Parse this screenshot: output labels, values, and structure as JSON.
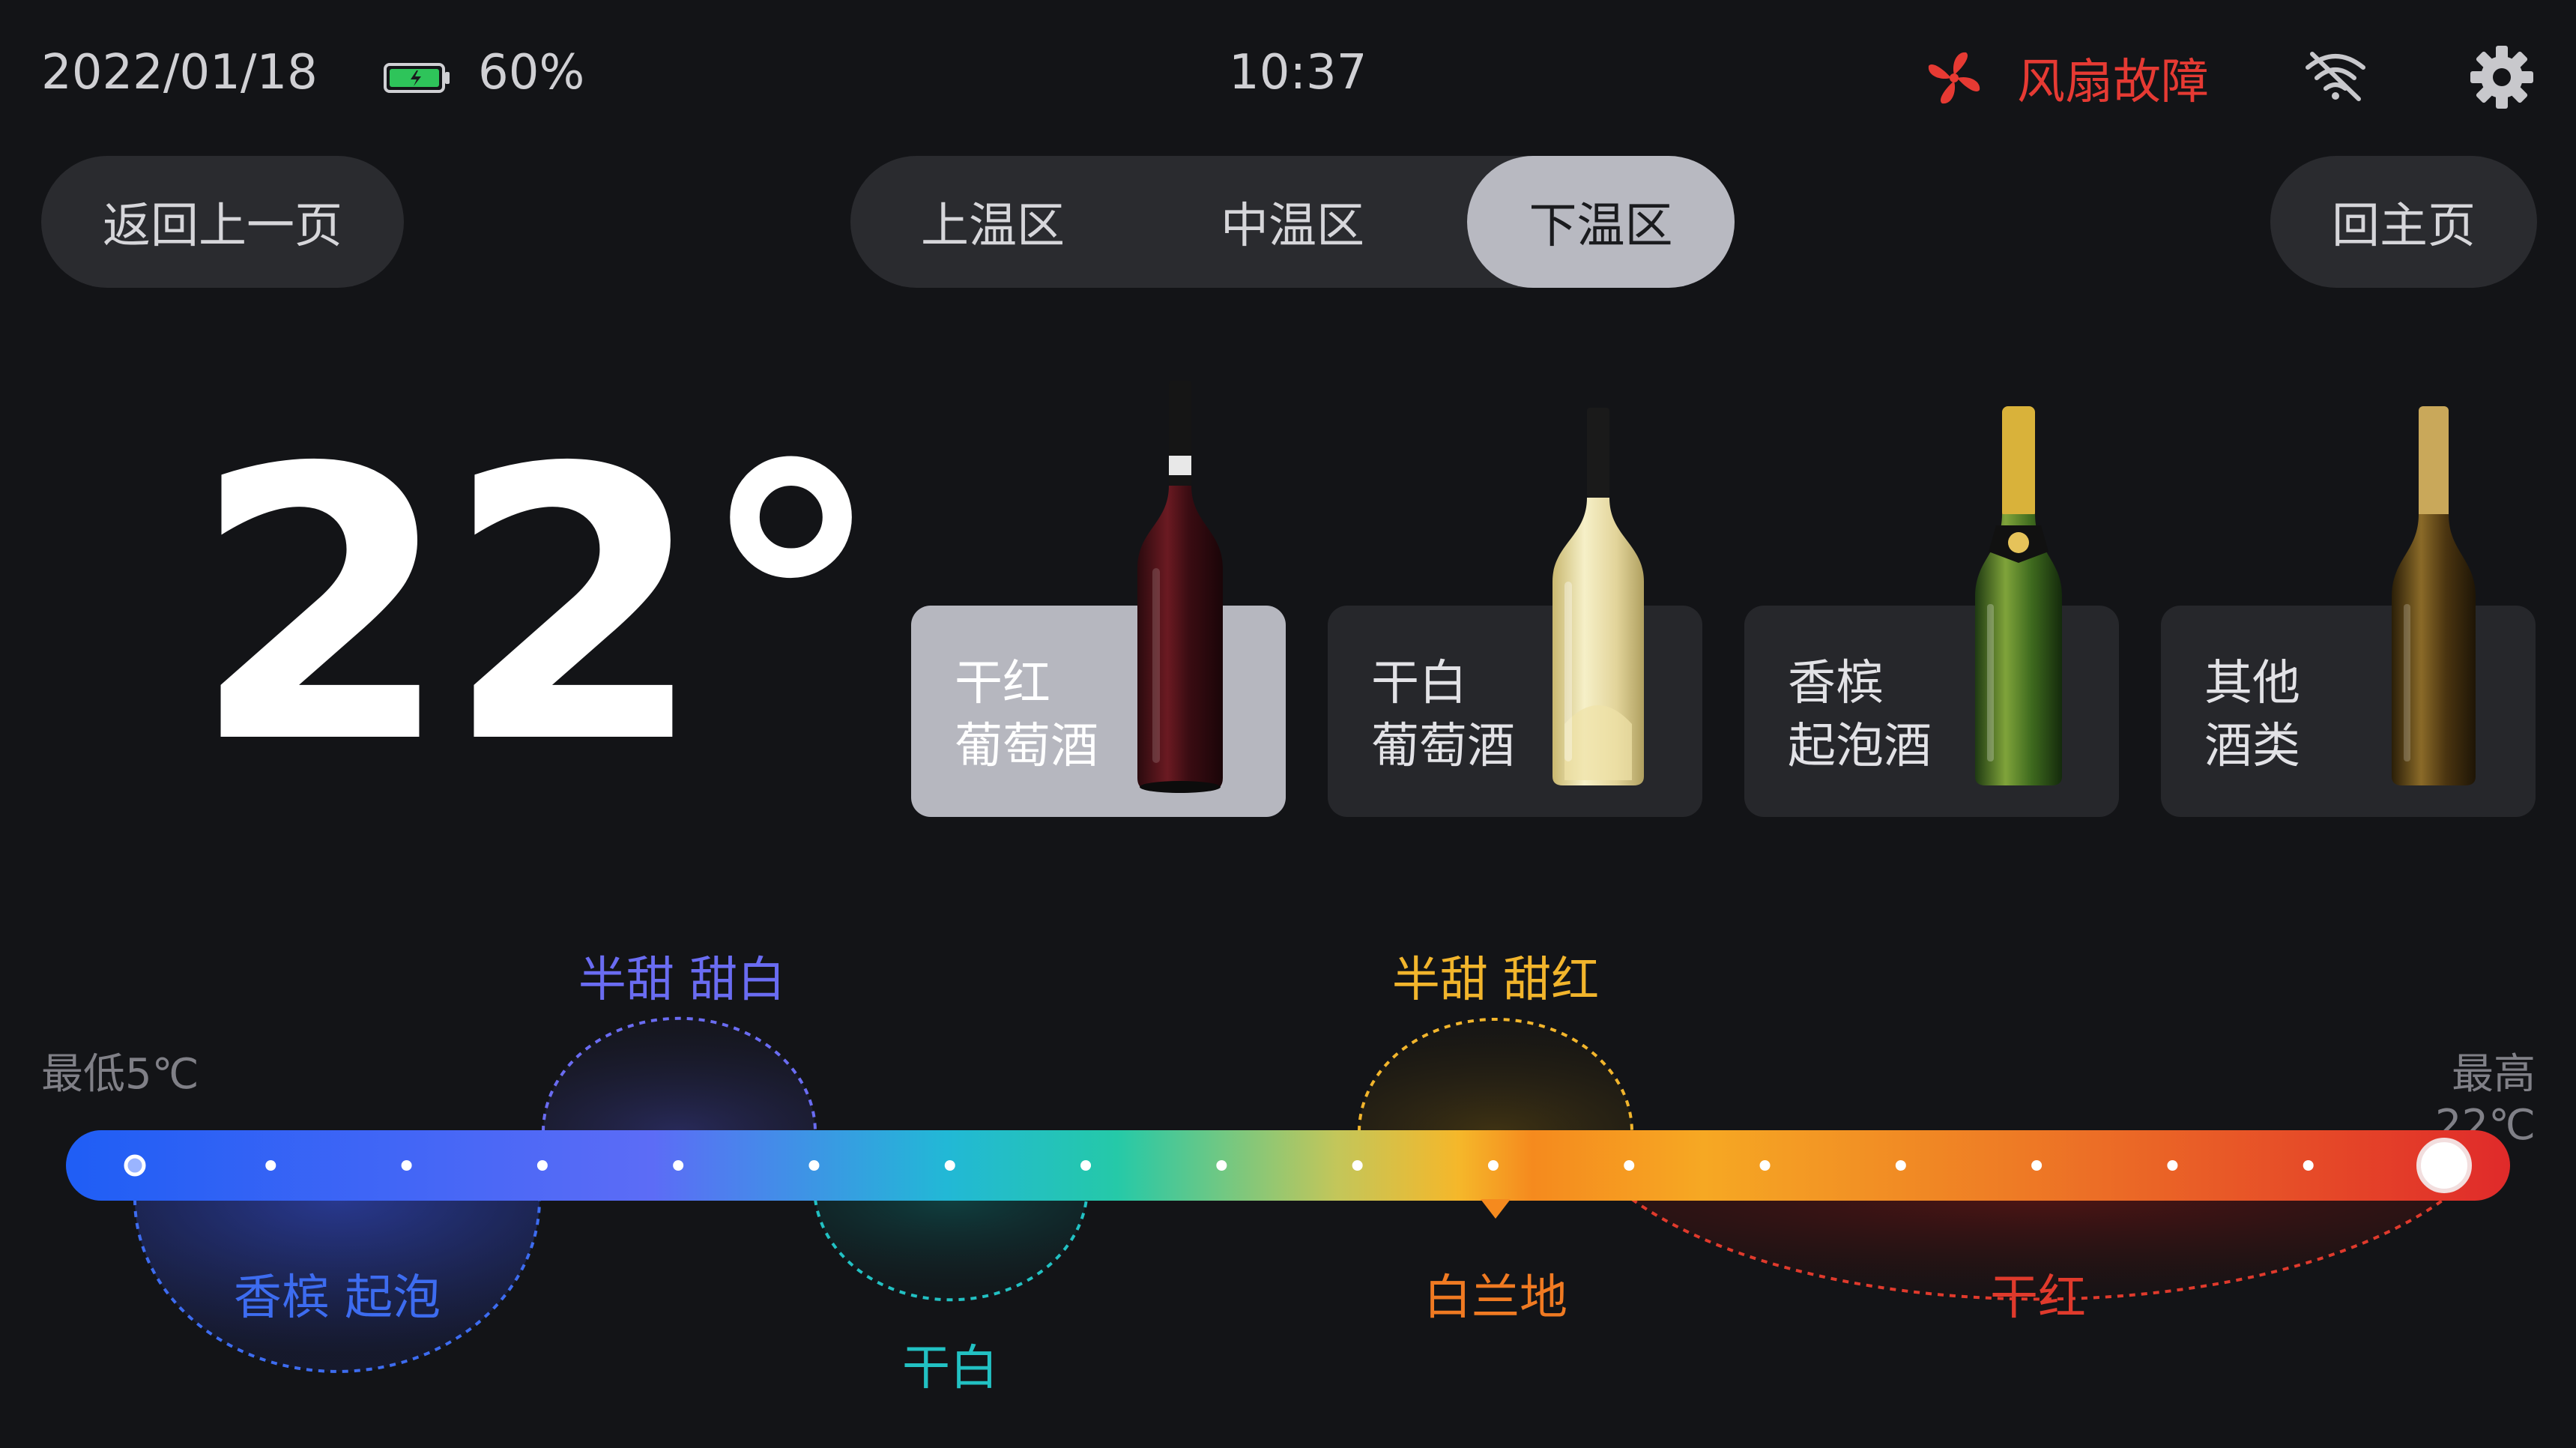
{
  "status_bar": {
    "date": "2022/01/18",
    "battery_percent": "60%",
    "time": "10:37",
    "alert_text": "风扇故障",
    "alert_color": "#e63a33"
  },
  "nav": {
    "back_label": "返回上一页",
    "home_label": "回主页",
    "zones": [
      {
        "label": "上温区",
        "active": false
      },
      {
        "label": "中温区",
        "active": false
      },
      {
        "label": "下温区",
        "active": true
      }
    ]
  },
  "temperature": {
    "value": "22°"
  },
  "wine_types": [
    {
      "line1": "干红",
      "line2": "葡萄酒",
      "active": true
    },
    {
      "line1": "干白",
      "line2": "葡萄酒",
      "active": false
    },
    {
      "line1": "香槟",
      "line2": "起泡酒",
      "active": false
    },
    {
      "line1": "其他",
      "line2": "酒类",
      "active": false
    }
  ],
  "scale": {
    "min_label": "最低5℃",
    "max_label": "最高22℃",
    "current_value": 22,
    "zones": [
      {
        "name": "香槟 起泡",
        "color": "#3d6cf0"
      },
      {
        "name": "半甜 甜白",
        "color": "#6a6cf2"
      },
      {
        "name": "干白",
        "color": "#22c1c3"
      },
      {
        "name": "半甜 甜红",
        "color": "#f2b52c"
      },
      {
        "name": "白兰地",
        "color": "#f07a22"
      },
      {
        "name": "干红",
        "color": "#e03a2c"
      }
    ]
  }
}
